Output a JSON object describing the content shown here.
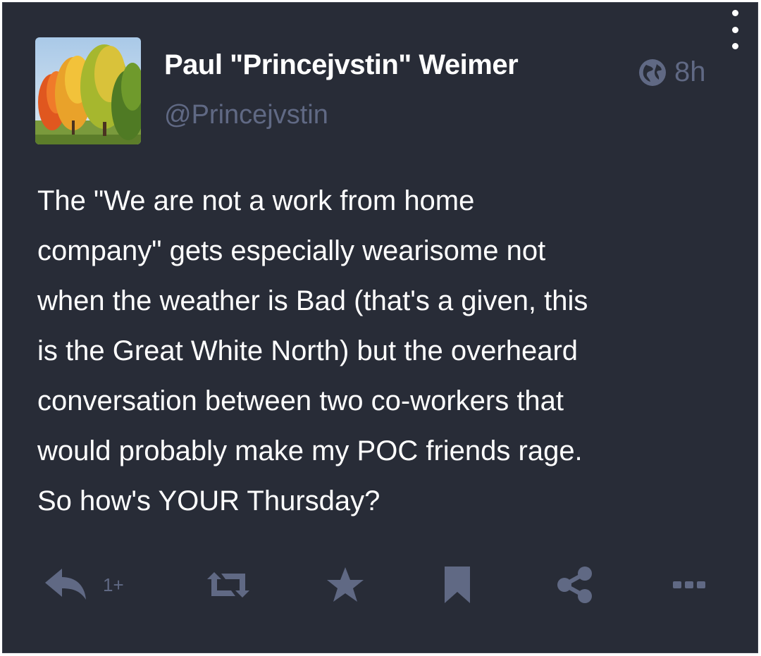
{
  "status": {
    "author": {
      "display_name": "Paul \"Princejvstin\" Weimer",
      "handle": "@Princejvstin",
      "avatar_icon": "autumn-trees-avatar"
    },
    "visibility_icon": "globe-icon",
    "timestamp": "8h",
    "content_lines": [
      "The \"We are not a work from home",
      "company\" gets especially wearisome not",
      "when the weather is Bad (that's a given, this",
      "is the Great White North) but the overheard",
      "conversation between two co-workers that",
      "would probably make my POC friends rage.",
      "So how's YOUR Thursday?"
    ],
    "actions": {
      "reply_icon": "reply-icon",
      "reply_count": "1+",
      "boost_icon": "boost-icon",
      "favourite_icon": "star-icon",
      "bookmark_icon": "bookmark-icon",
      "share_icon": "share-icon",
      "more_icon": "more-icon"
    }
  },
  "colors": {
    "background": "#282c37",
    "text": "#ffffff",
    "muted": "#606984"
  }
}
